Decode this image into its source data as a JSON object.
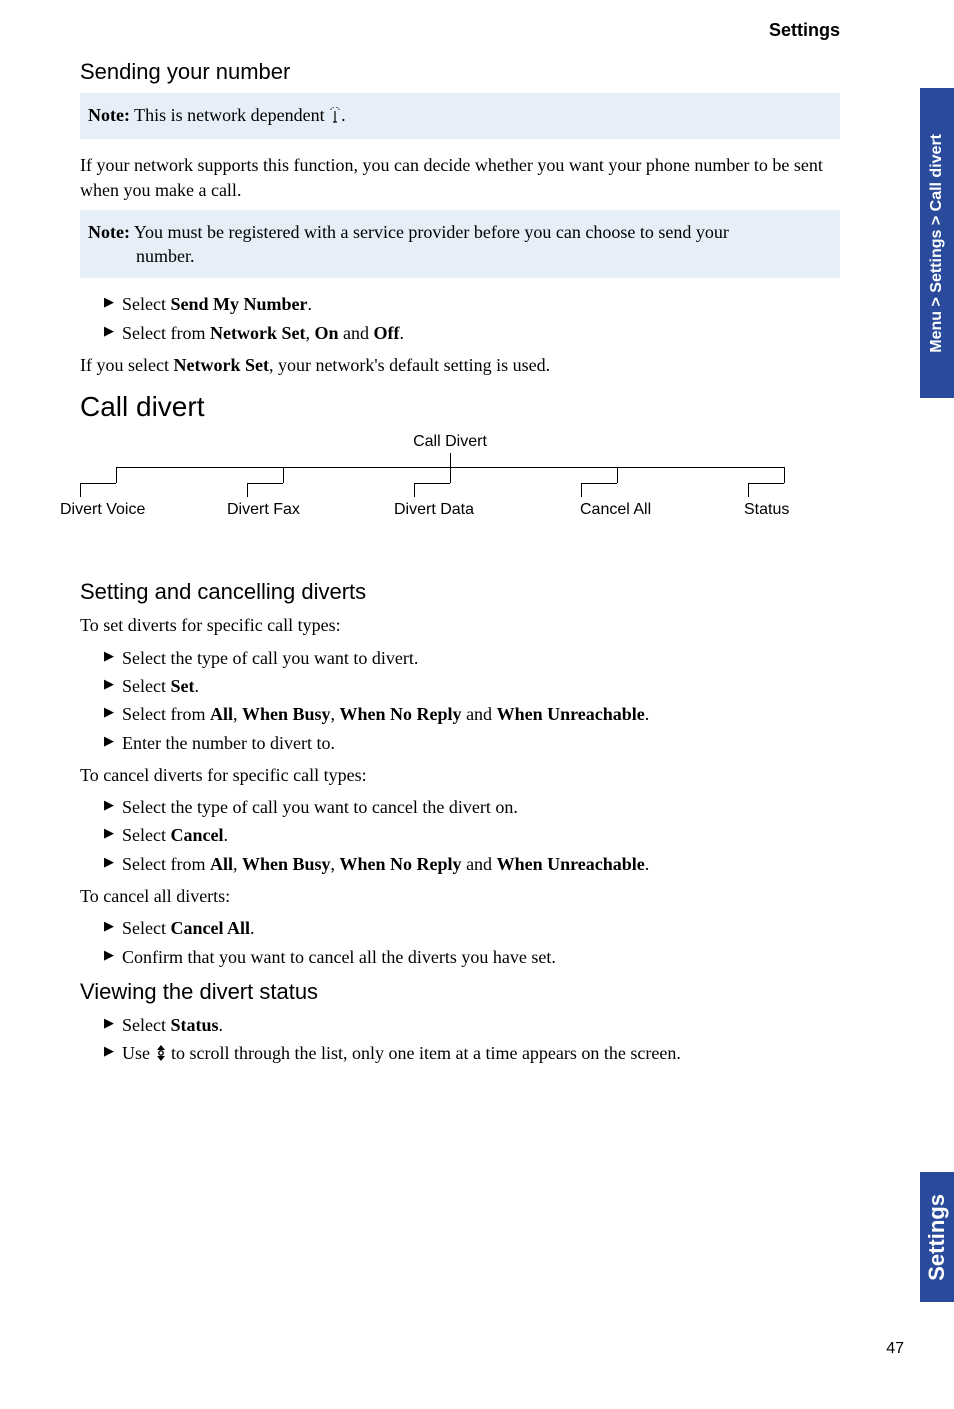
{
  "header": {
    "settings": "Settings"
  },
  "sidetab": {
    "breadcrumb": "Menu > Settings > Call divert",
    "section": "Settings"
  },
  "page_number": "47",
  "s1": {
    "title": "Sending your number",
    "note1_label": "Note:",
    "note1_text": " This is network dependent ",
    "note1_tail": ".",
    "para1": "If your network supports this function, you can decide whether you want your phone number to be sent when you make a call.",
    "note2_label": "Note:",
    "note2_text_a": " You must be registered with a service provider before you can choose to send your",
    "note2_text_b": "number.",
    "li1_a": "Select ",
    "li1_b": "Send My Number",
    "li1_c": ".",
    "li2_a": "Select from ",
    "li2_b": "Network Set",
    "li2_c": ", ",
    "li2_d": "On",
    "li2_e": " and ",
    "li2_f": "Off",
    "li2_g": ".",
    "para2_a": "If you select ",
    "para2_b": "Network Set",
    "para2_c": ", your network's default setting is used."
  },
  "s2": {
    "title": "Call divert",
    "diagram_title": "Call Divert",
    "labels": {
      "l1": "Divert Voice",
      "l2": "Divert Fax",
      "l3": "Divert Data",
      "l4": "Cancel All",
      "l5": "Status"
    }
  },
  "s3": {
    "title": "Setting and cancelling diverts",
    "p1": "To set diverts for specific call types:",
    "li1": "Select the type of call you want to divert.",
    "li2_a": "Select ",
    "li2_b": "Set",
    "li2_c": ".",
    "li3_a": "Select from ",
    "li3_b": "All",
    "li3_c": ", ",
    "li3_d": "When Busy",
    "li3_e": ", ",
    "li3_f": "When No Reply",
    "li3_g": " and ",
    "li3_h": "When Unreachable",
    "li3_i": ".",
    "li4": "Enter the number to divert to.",
    "p2": "To cancel diverts for specific call types:",
    "li5": "Select the type of call you want to cancel the divert on.",
    "li6_a": "Select ",
    "li6_b": "Cancel",
    "li6_c": ".",
    "li7_a": "Select from ",
    "li7_b": "All",
    "li7_c": ", ",
    "li7_d": "When Busy",
    "li7_e": ", ",
    "li7_f": "When No Reply",
    "li7_g": " and ",
    "li7_h": "When Unreachable",
    "li7_i": ".",
    "p3": "To cancel all diverts:",
    "li8_a": "Select ",
    "li8_b": "Cancel All",
    "li8_c": ".",
    "li9": "Confirm that you want to cancel all the diverts you have set."
  },
  "s4": {
    "title": "Viewing the divert status",
    "li1_a": "Select ",
    "li1_b": "Status",
    "li1_c": ".",
    "li2_a": "Use ",
    "li2_b": " to scroll through the list, only one item at a time appears on the screen."
  }
}
